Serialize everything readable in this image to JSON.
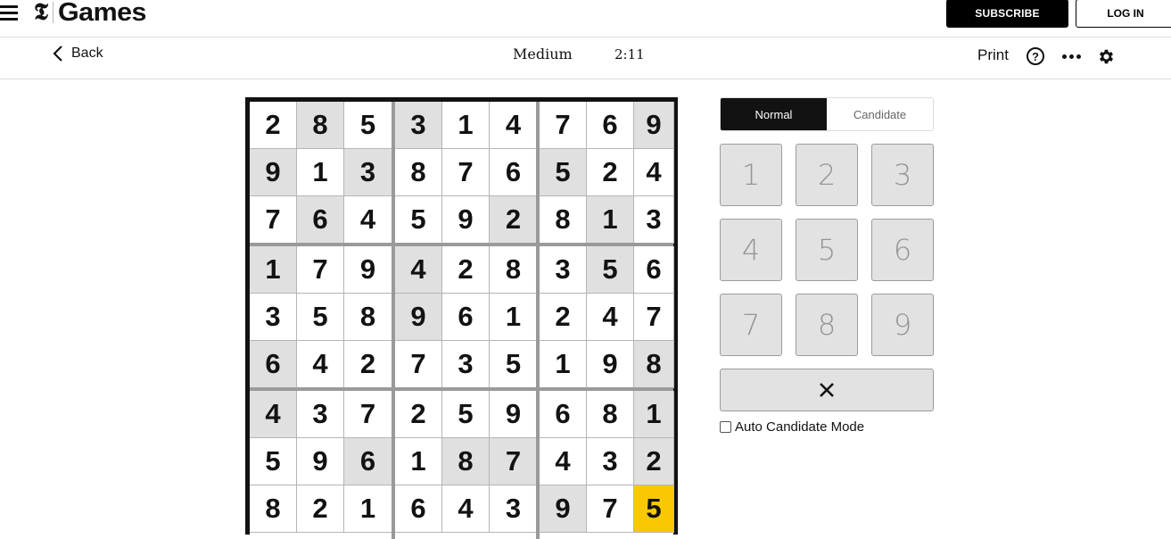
{
  "header": {
    "logo_mark": "𝕿",
    "logo_text": "Games",
    "subscribe_label": "SUBSCRIBE",
    "login_label": "LOG IN"
  },
  "toolbar": {
    "back_label": "Back",
    "difficulty": "Medium",
    "timer": "2:11",
    "print_label": "Print",
    "help_label": "?"
  },
  "board": {
    "rows": [
      [
        2,
        8,
        5,
        3,
        1,
        4,
        7,
        6,
        9
      ],
      [
        9,
        1,
        3,
        8,
        7,
        6,
        5,
        2,
        4
      ],
      [
        7,
        6,
        4,
        5,
        9,
        2,
        8,
        1,
        3
      ],
      [
        1,
        7,
        9,
        4,
        2,
        8,
        3,
        5,
        6
      ],
      [
        3,
        5,
        8,
        9,
        6,
        1,
        2,
        4,
        7
      ],
      [
        6,
        4,
        2,
        7,
        3,
        5,
        1,
        9,
        8
      ],
      [
        4,
        3,
        7,
        2,
        5,
        9,
        6,
        8,
        1
      ],
      [
        5,
        9,
        6,
        1,
        8,
        7,
        4,
        3,
        2
      ],
      [
        8,
        2,
        1,
        6,
        4,
        3,
        9,
        7,
        5
      ]
    ],
    "given": [
      [
        0,
        1,
        0,
        1,
        0,
        0,
        0,
        0,
        1
      ],
      [
        1,
        0,
        1,
        0,
        0,
        0,
        1,
        0,
        0
      ],
      [
        0,
        1,
        0,
        0,
        0,
        1,
        0,
        1,
        0
      ],
      [
        1,
        0,
        0,
        1,
        0,
        0,
        0,
        1,
        0
      ],
      [
        0,
        0,
        0,
        1,
        0,
        0,
        0,
        0,
        0
      ],
      [
        1,
        0,
        0,
        0,
        0,
        0,
        0,
        0,
        1
      ],
      [
        1,
        0,
        0,
        0,
        0,
        0,
        0,
        0,
        1
      ],
      [
        0,
        0,
        1,
        0,
        1,
        1,
        0,
        0,
        1
      ],
      [
        0,
        0,
        0,
        0,
        0,
        0,
        1,
        0,
        0
      ]
    ],
    "selected": [
      8,
      8
    ],
    "colors": {
      "given": "#e0e0e0",
      "selected": "#fac800"
    }
  },
  "controls": {
    "modes": [
      "Normal",
      "Candidate"
    ],
    "active_mode": "Normal",
    "numpad": [
      "1",
      "2",
      "3",
      "4",
      "5",
      "6",
      "7",
      "8",
      "9"
    ],
    "erase_icon": "close-icon",
    "auto_candidate_label": "Auto Candidate Mode",
    "auto_candidate_checked": false
  }
}
